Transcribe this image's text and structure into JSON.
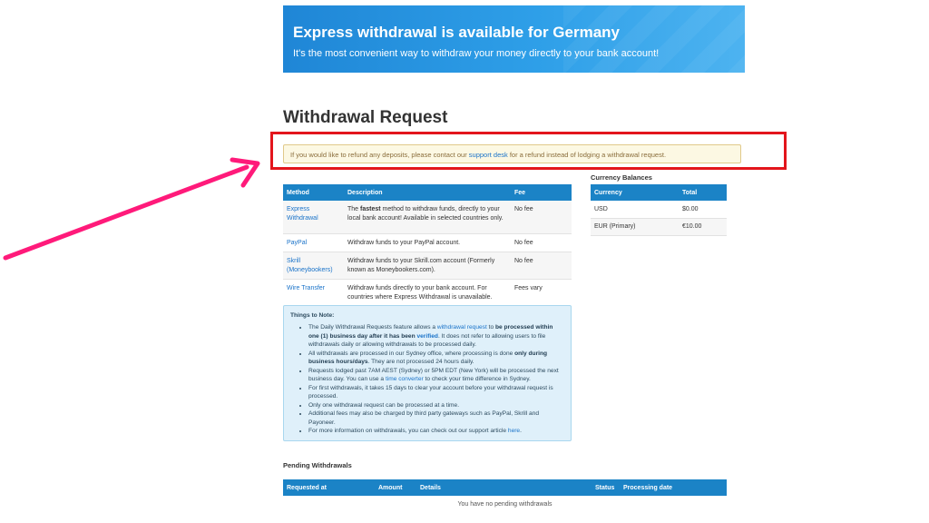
{
  "banner": {
    "title": "Express withdrawal is available for Germany",
    "subtitle": "It's the most convenient way to withdraw your money directly to your bank account!"
  },
  "page_title": "Withdrawal Request",
  "notice": {
    "before": "If you would like to refund any deposits, please contact our ",
    "link": "support desk",
    "after": " for a refund instead of lodging a withdrawal request."
  },
  "methods": {
    "headers": [
      "Method",
      "Description",
      "Fee"
    ],
    "rows": [
      {
        "method": "Express Withdrawal",
        "desc_pre": "The ",
        "desc_bold": "fastest",
        "desc_post": " method to withdraw funds, directly to your local bank account! Available in selected countries only.",
        "fee": "No fee"
      },
      {
        "method": "PayPal",
        "desc_pre": "Withdraw funds to your PayPal account.",
        "desc_bold": "",
        "desc_post": "",
        "fee": "No fee"
      },
      {
        "method": "Skrill (Moneybookers)",
        "desc_pre": "Withdraw funds to your Skrill.com account (Formerly known as Moneybookers.com).",
        "desc_bold": "",
        "desc_post": "",
        "fee": "No fee"
      },
      {
        "method": "Wire Transfer",
        "desc_pre": "Withdraw funds directly to your bank account. For countries where Express Withdrawal is unavailable.",
        "desc_bold": "",
        "desc_post": "",
        "fee": "Fees vary"
      }
    ]
  },
  "balances": {
    "title": "Currency Balances",
    "headers": [
      "Currency",
      "Total"
    ],
    "rows": [
      {
        "currency": "USD",
        "total": "$0.00"
      },
      {
        "currency": "EUR (Primary)",
        "total": "€10.00"
      }
    ]
  },
  "notes": {
    "title": "Things to Note:",
    "items": {
      "i1": {
        "a": "The Daily Withdrawal Requests feature allows a ",
        "link1": "withdrawal request",
        "b": " to ",
        "bold": "be processed within one (1) business day after it has been ",
        "link2": "verified",
        "c": ". It does not refer to allowing users to file withdrawals daily or allowing withdrawals to be processed daily."
      },
      "i2": {
        "a": "All withdrawals are processed in our Sydney office, where processing is done ",
        "bold": "only during business hours/days",
        "b": ". They are not processed 24 hours daily."
      },
      "i3": {
        "a": "Requests lodged past 7AM AEST (Sydney) or 5PM EDT (New York) will be processed the next business day. You can use a ",
        "link": "time converter",
        "b": " to check your time difference in Sydney."
      },
      "i4": "For first withdrawals, it takes 15 days to clear your account before your withdrawal request is processed.",
      "i5": "Only one withdrawal request can be processed at a time.",
      "i6": "Additional fees may also be charged by third party gateways such as PayPal, Skrill and Payoneer.",
      "i7": {
        "a": "For more information on withdrawals, you can check out our support article ",
        "link": "here",
        "b": "."
      }
    }
  },
  "pending": {
    "title": "Pending Withdrawals",
    "headers": [
      "Requested at",
      "Amount",
      "Details",
      "Status",
      "Processing date"
    ],
    "empty": "You have no pending withdrawals"
  },
  "colors": {
    "accent": "#1b83c6",
    "highlight": "#e3151c",
    "arrow": "#ff1a7a"
  }
}
